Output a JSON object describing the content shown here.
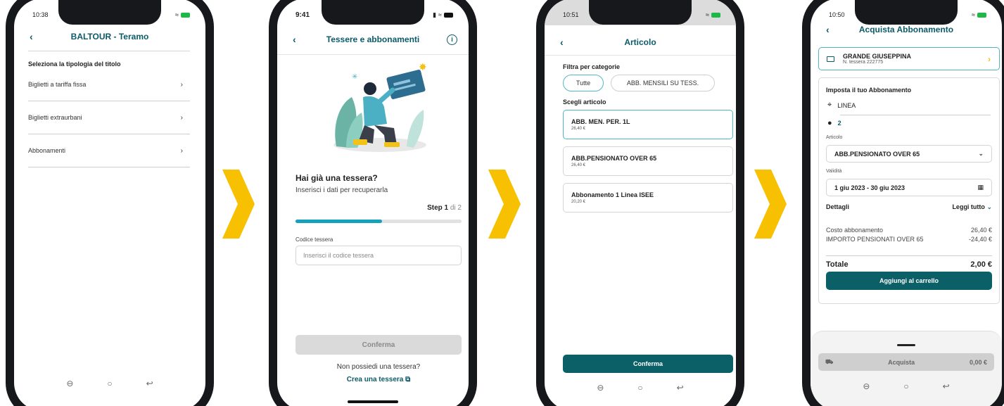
{
  "colors": {
    "accent": "#0b5a68",
    "button": "#0b5f66",
    "progress": "#14a1b9",
    "arrow": "#f7c000"
  },
  "screen1": {
    "status_time": "10:38",
    "title": "BALTOUR - Teramo",
    "heading": "Seleziona la tipologia del titolo",
    "items": [
      {
        "label": "Biglietti a tariffa fissa"
      },
      {
        "label": "Biglietti extraurbani"
      },
      {
        "label": "Abbonamenti"
      }
    ],
    "nav_icons": [
      "recent-apps-icon",
      "home-icon",
      "back-icon"
    ]
  },
  "screen2": {
    "status_time": "9:41",
    "title": "Tessere e abbonamenti",
    "question": "Hai già una tessera?",
    "subtitle": "Inserisci i dati per recuperarla",
    "step_label": "Step 1",
    "step_of": "di 2",
    "progress": 0.52,
    "field_label": "Codice tessera",
    "field_placeholder": "Inserisci il codice tessera",
    "confirm": "Conferma",
    "no_card": "Non possiedi una tessera?",
    "create": "Crea una tessera"
  },
  "screen3": {
    "status_time": "10:51",
    "title": "Articolo",
    "filter_heading": "Filtra per categorie",
    "chips": [
      "Tutte",
      "ABB. MENSILI  SU TESS."
    ],
    "choose_heading": "Scegli articolo",
    "articles": [
      {
        "name": "ABB. MEN. PER. 1L",
        "price": "26,40 €"
      },
      {
        "name": "ABB.PENSIONATO OVER 65",
        "price": "26,40 €"
      },
      {
        "name": "Abbonamento 1 Linea ISEE",
        "price": "20,20 €"
      }
    ],
    "confirm": "Conferma"
  },
  "screen4": {
    "status_time": "10:50",
    "title": "Acquista Abbonamento",
    "user_name": "GRANDE GIUSEPPINA",
    "user_card": "N. tessera 222775",
    "panel_title": "Imposta il tuo Abbonamento",
    "line_label": "LINEA",
    "line_value": "2",
    "article_label": "Articolo",
    "article_value": "ABB.PENSIONATO OVER 65",
    "validity_label": "Validità",
    "validity_value": "1 giu 2023 - 30 giu 2023",
    "details_label": "Dettagli",
    "read_all": "Leggi tutto",
    "cost_label": "Costo abbonamento",
    "cost_value": "26,40 €",
    "discount_label": "IMPORTO PENSIONATI OVER 65",
    "discount_value": "-24,40 €",
    "total_label": "Totale",
    "total_value": "2,00 €",
    "add_button": "Aggiungi al carrello",
    "buy_label": "Acquista",
    "buy_value": "0,00 €"
  }
}
